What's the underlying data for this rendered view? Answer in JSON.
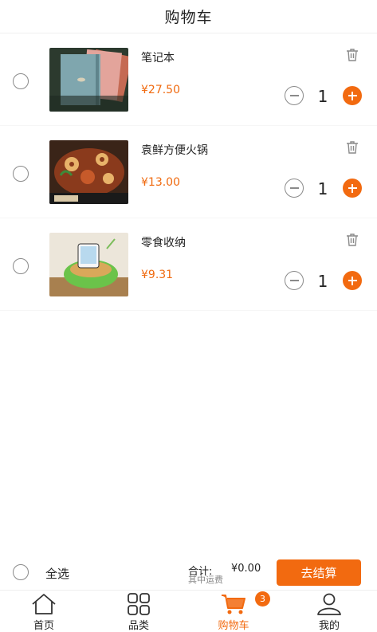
{
  "header": {
    "title": "购物车"
  },
  "cart": {
    "items": [
      {
        "name": "笔记本",
        "price": "¥27.50",
        "quantity": "1"
      },
      {
        "name": "袁鲜方便火锅",
        "price": "¥13.00",
        "quantity": "1"
      },
      {
        "name": "零食收纳",
        "price": "¥9.31",
        "quantity": "1"
      }
    ]
  },
  "checkout": {
    "select_all_label": "全选",
    "total_label": "合计:",
    "total_value": "¥0.00",
    "shipping_label": "其中运费",
    "checkout_button": "去结算"
  },
  "tabbar": {
    "tabs": [
      {
        "label": "首页",
        "icon": "home-icon"
      },
      {
        "label": "品类",
        "icon": "category-grid-icon"
      },
      {
        "label": "购物车",
        "icon": "cart-icon",
        "active": true
      },
      {
        "label": "我的",
        "icon": "user-icon"
      }
    ],
    "cart_badge": "3"
  },
  "colors": {
    "accent": "#f26a10",
    "price": "#f06a0f"
  }
}
